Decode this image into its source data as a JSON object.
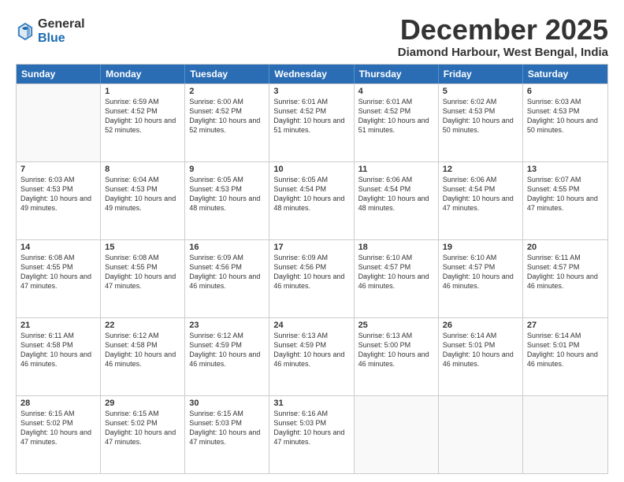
{
  "logo": {
    "general": "General",
    "blue": "Blue"
  },
  "title": "December 2025",
  "location": "Diamond Harbour, West Bengal, India",
  "days_of_week": [
    "Sunday",
    "Monday",
    "Tuesday",
    "Wednesday",
    "Thursday",
    "Friday",
    "Saturday"
  ],
  "weeks": [
    [
      {
        "day": "",
        "empty": true
      },
      {
        "day": "1",
        "sunrise": "6:59 AM",
        "sunset": "4:52 PM",
        "daylight": "10 hours and 52 minutes."
      },
      {
        "day": "2",
        "sunrise": "6:00 AM",
        "sunset": "4:52 PM",
        "daylight": "10 hours and 52 minutes."
      },
      {
        "day": "3",
        "sunrise": "6:01 AM",
        "sunset": "4:52 PM",
        "daylight": "10 hours and 51 minutes."
      },
      {
        "day": "4",
        "sunrise": "6:01 AM",
        "sunset": "4:52 PM",
        "daylight": "10 hours and 51 minutes."
      },
      {
        "day": "5",
        "sunrise": "6:02 AM",
        "sunset": "4:53 PM",
        "daylight": "10 hours and 50 minutes."
      },
      {
        "day": "6",
        "sunrise": "6:03 AM",
        "sunset": "4:53 PM",
        "daylight": "10 hours and 50 minutes."
      }
    ],
    [
      {
        "day": "7",
        "sunrise": "6:03 AM",
        "sunset": "4:53 PM",
        "daylight": "10 hours and 49 minutes."
      },
      {
        "day": "8",
        "sunrise": "6:04 AM",
        "sunset": "4:53 PM",
        "daylight": "10 hours and 49 minutes."
      },
      {
        "day": "9",
        "sunrise": "6:05 AM",
        "sunset": "4:53 PM",
        "daylight": "10 hours and 48 minutes."
      },
      {
        "day": "10",
        "sunrise": "6:05 AM",
        "sunset": "4:54 PM",
        "daylight": "10 hours and 48 minutes."
      },
      {
        "day": "11",
        "sunrise": "6:06 AM",
        "sunset": "4:54 PM",
        "daylight": "10 hours and 48 minutes."
      },
      {
        "day": "12",
        "sunrise": "6:06 AM",
        "sunset": "4:54 PM",
        "daylight": "10 hours and 47 minutes."
      },
      {
        "day": "13",
        "sunrise": "6:07 AM",
        "sunset": "4:55 PM",
        "daylight": "10 hours and 47 minutes."
      }
    ],
    [
      {
        "day": "14",
        "sunrise": "6:08 AM",
        "sunset": "4:55 PM",
        "daylight": "10 hours and 47 minutes."
      },
      {
        "day": "15",
        "sunrise": "6:08 AM",
        "sunset": "4:55 PM",
        "daylight": "10 hours and 47 minutes."
      },
      {
        "day": "16",
        "sunrise": "6:09 AM",
        "sunset": "4:56 PM",
        "daylight": "10 hours and 46 minutes."
      },
      {
        "day": "17",
        "sunrise": "6:09 AM",
        "sunset": "4:56 PM",
        "daylight": "10 hours and 46 minutes."
      },
      {
        "day": "18",
        "sunrise": "6:10 AM",
        "sunset": "4:57 PM",
        "daylight": "10 hours and 46 minutes."
      },
      {
        "day": "19",
        "sunrise": "6:10 AM",
        "sunset": "4:57 PM",
        "daylight": "10 hours and 46 minutes."
      },
      {
        "day": "20",
        "sunrise": "6:11 AM",
        "sunset": "4:57 PM",
        "daylight": "10 hours and 46 minutes."
      }
    ],
    [
      {
        "day": "21",
        "sunrise": "6:11 AM",
        "sunset": "4:58 PM",
        "daylight": "10 hours and 46 minutes."
      },
      {
        "day": "22",
        "sunrise": "6:12 AM",
        "sunset": "4:58 PM",
        "daylight": "10 hours and 46 minutes."
      },
      {
        "day": "23",
        "sunrise": "6:12 AM",
        "sunset": "4:59 PM",
        "daylight": "10 hours and 46 minutes."
      },
      {
        "day": "24",
        "sunrise": "6:13 AM",
        "sunset": "4:59 PM",
        "daylight": "10 hours and 46 minutes."
      },
      {
        "day": "25",
        "sunrise": "6:13 AM",
        "sunset": "5:00 PM",
        "daylight": "10 hours and 46 minutes."
      },
      {
        "day": "26",
        "sunrise": "6:14 AM",
        "sunset": "5:01 PM",
        "daylight": "10 hours and 46 minutes."
      },
      {
        "day": "27",
        "sunrise": "6:14 AM",
        "sunset": "5:01 PM",
        "daylight": "10 hours and 46 minutes."
      }
    ],
    [
      {
        "day": "28",
        "sunrise": "6:15 AM",
        "sunset": "5:02 PM",
        "daylight": "10 hours and 47 minutes."
      },
      {
        "day": "29",
        "sunrise": "6:15 AM",
        "sunset": "5:02 PM",
        "daylight": "10 hours and 47 minutes."
      },
      {
        "day": "30",
        "sunrise": "6:15 AM",
        "sunset": "5:03 PM",
        "daylight": "10 hours and 47 minutes."
      },
      {
        "day": "31",
        "sunrise": "6:16 AM",
        "sunset": "5:03 PM",
        "daylight": "10 hours and 47 minutes."
      },
      {
        "day": "",
        "empty": true
      },
      {
        "day": "",
        "empty": true
      },
      {
        "day": "",
        "empty": true
      }
    ]
  ]
}
